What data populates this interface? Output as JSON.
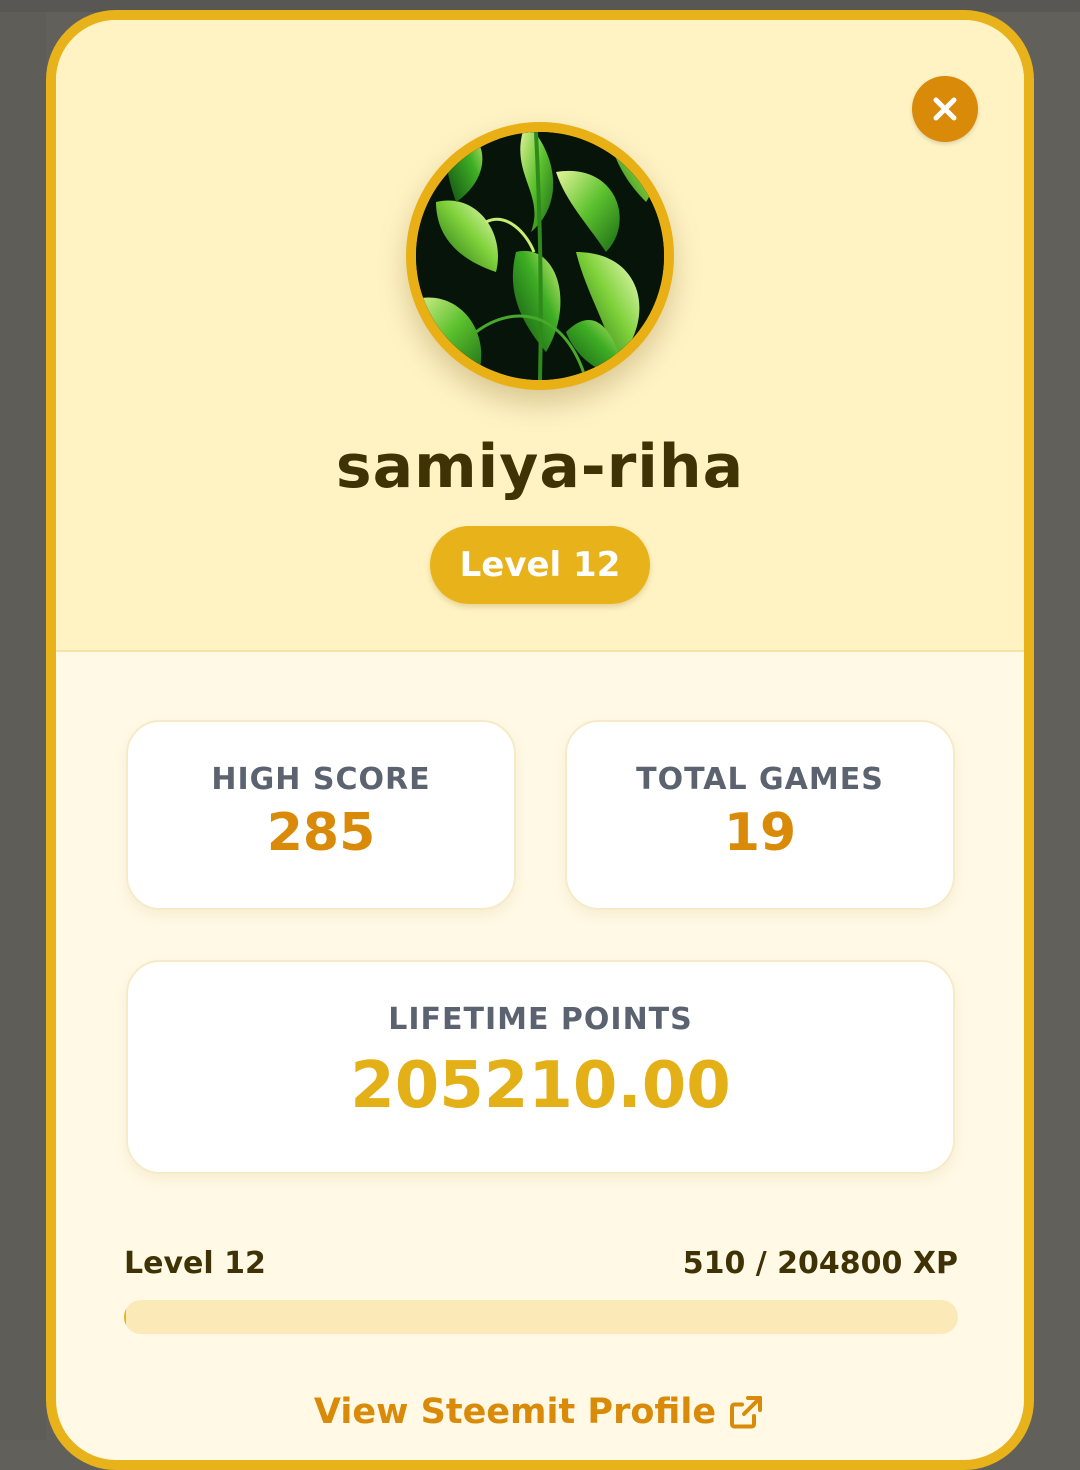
{
  "profile": {
    "username": "samiya-riha",
    "level_badge": "Level 12",
    "avatar_icon": "leaf-pattern-avatar"
  },
  "header": {
    "close_icon": "close-icon"
  },
  "stats": {
    "high_score": {
      "label": "HIGH SCORE",
      "value": "285"
    },
    "total_games": {
      "label": "TOTAL GAMES",
      "value": "19"
    },
    "lifetime_points": {
      "label": "LIFETIME POINTS",
      "value": "205210.00"
    }
  },
  "progress": {
    "level_label": "Level 12",
    "xp_text": "510 / 204800 XP",
    "current_xp": 510,
    "max_xp": 204800
  },
  "footer": {
    "profile_link_label": "View Steemit Profile",
    "link_icon": "external-link-icon"
  },
  "colors": {
    "accent": "#e8b21a",
    "accent_dark": "#d98a08",
    "header_bg": "#fff3c4",
    "body_bg": "#fff9e6",
    "text_dark": "#3f3306",
    "label_gray": "#5b6270"
  }
}
